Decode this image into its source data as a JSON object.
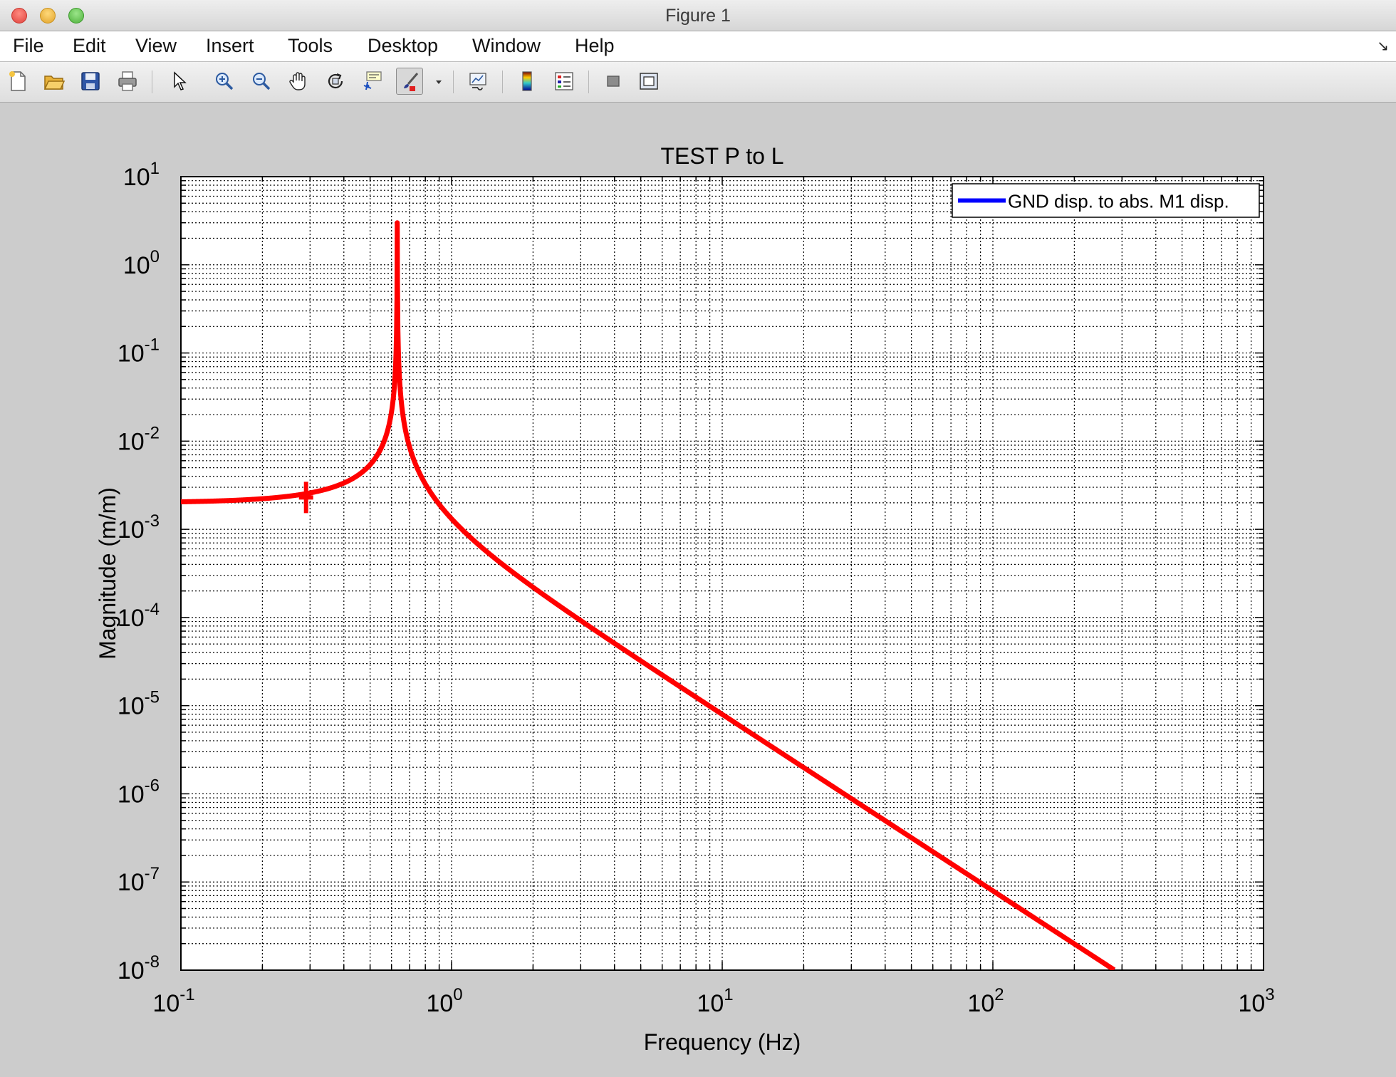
{
  "window": {
    "title": "Figure 1"
  },
  "menu": {
    "items": [
      "File",
      "Edit",
      "View",
      "Insert",
      "Tools",
      "Desktop",
      "Window",
      "Help"
    ],
    "corner_glyph": "↘"
  },
  "toolbar": {
    "icons": [
      "new-figure-icon",
      "open-file-icon",
      "save-icon",
      "print-icon",
      "select-arrow-icon",
      "zoom-in-icon",
      "zoom-out-icon",
      "pan-hand-icon",
      "rotate-3d-icon",
      "data-cursor-icon",
      "brush-icon",
      "brush-dropdown-icon",
      "link-plot-icon",
      "colorbar-icon",
      "legend-icon",
      "hide-plot-tools-icon",
      "show-plot-tools-icon"
    ],
    "active": "brush-icon"
  },
  "chart_data": {
    "type": "line",
    "title": "TEST P to L",
    "xlabel": "Frequency (Hz)",
    "ylabel": "Magnitude (m/m)",
    "xscale": "log",
    "yscale": "log",
    "xlim": [
      0.1,
      1000
    ],
    "ylim": [
      1e-08,
      10
    ],
    "grid": true,
    "minor_grid": true,
    "x_ticks": [
      {
        "base": "10",
        "exp": "-1"
      },
      {
        "base": "10",
        "exp": "0"
      },
      {
        "base": "10",
        "exp": "1"
      },
      {
        "base": "10",
        "exp": "2"
      },
      {
        "base": "10",
        "exp": "3"
      }
    ],
    "y_ticks": [
      {
        "base": "10",
        "exp": "-8"
      },
      {
        "base": "10",
        "exp": "-7"
      },
      {
        "base": "10",
        "exp": "-6"
      },
      {
        "base": "10",
        "exp": "-5"
      },
      {
        "base": "10",
        "exp": "-4"
      },
      {
        "base": "10",
        "exp": "-3"
      },
      {
        "base": "10",
        "exp": "-2"
      },
      {
        "base": "10",
        "exp": "-1"
      },
      {
        "base": "10",
        "exp": "0"
      },
      {
        "base": "10",
        "exp": "1"
      }
    ],
    "legend": {
      "position": "top-right",
      "entries": [
        {
          "label": "GND disp. to abs. M1 disp.",
          "color": "#0000ff"
        }
      ]
    },
    "series": [
      {
        "name": "GND disp. to abs. M1 disp.",
        "color": "#0000ff",
        "resonance_hz": 0.63,
        "peak": 0.25,
        "low_freq_level": 0.002,
        "high_freq_slope": -2,
        "x": [
          0.1,
          0.2,
          0.3,
          0.4,
          0.5,
          0.55,
          0.6,
          0.62,
          0.63,
          0.65,
          0.7,
          0.8,
          1,
          2,
          3,
          10,
          100,
          290
        ],
        "y": [
          0.002,
          0.0021,
          0.0025,
          0.0035,
          0.0065,
          0.011,
          0.035,
          0.09,
          0.25,
          0.05,
          0.011,
          0.0028,
          0.0012,
          0.00025,
          0.0001,
          1e-05,
          1e-07,
          1e-08
        ]
      },
      {
        "color": "#ff0000",
        "resonance_hz": 0.63,
        "peak": 3,
        "low_freq_level": 0.002,
        "high_freq_slope": -2,
        "x": [
          0.1,
          0.2,
          0.3,
          0.4,
          0.5,
          0.55,
          0.6,
          0.62,
          0.63,
          0.65,
          0.7,
          0.8,
          1,
          2,
          3,
          10,
          100,
          290
        ],
        "y": [
          0.002,
          0.0021,
          0.0025,
          0.0035,
          0.0065,
          0.011,
          0.035,
          0.09,
          3,
          0.05,
          0.011,
          0.0028,
          0.0012,
          0.00025,
          0.0001,
          1e-05,
          1e-07,
          1e-08
        ],
        "marker": {
          "x": 0.29,
          "y": 0.0023,
          "symbol": "+"
        }
      }
    ]
  },
  "colors": {
    "figure_bg": "#cccccc",
    "axes_bg": "#ffffff",
    "grid": "#000000"
  }
}
